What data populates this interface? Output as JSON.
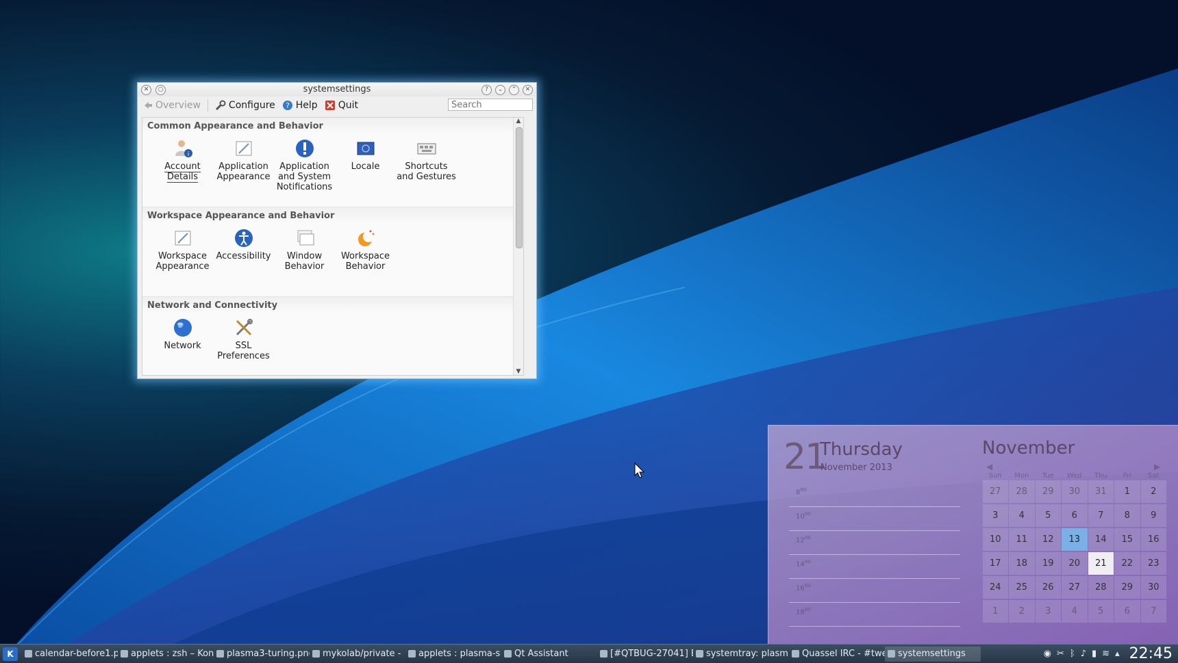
{
  "window": {
    "title": "systemsettings",
    "toolbar": {
      "overview": "Overview",
      "configure": "Configure",
      "help": "Help",
      "quit": "Quit",
      "search_placeholder": "Search"
    },
    "categories": [
      {
        "header": "Common Appearance and Behavior",
        "items": [
          {
            "line1": "Account",
            "line2": "Details",
            "line3": "",
            "icon": "user-info-icon"
          },
          {
            "line1": "Application",
            "line2": "Appearance",
            "line3": "",
            "icon": "brush-icon"
          },
          {
            "line1": "Application",
            "line2": "and System",
            "line3": "Notifications",
            "icon": "exclamation-icon"
          },
          {
            "line1": "Locale",
            "line2": "",
            "line3": "",
            "icon": "flag-icon"
          },
          {
            "line1": "Shortcuts",
            "line2": "and Gestures",
            "line3": "",
            "icon": "keyboard-icon"
          }
        ]
      },
      {
        "header": "Workspace Appearance and Behavior",
        "items": [
          {
            "line1": "Workspace",
            "line2": "Appearance",
            "line3": "",
            "icon": "brush-icon"
          },
          {
            "line1": "Accessibility",
            "line2": "",
            "line3": "",
            "icon": "accessibility-icon"
          },
          {
            "line1": "Window",
            "line2": "Behavior",
            "line3": "",
            "icon": "window-icon"
          },
          {
            "line1": "Workspace",
            "line2": "Behavior",
            "line3": "",
            "icon": "moon-icon"
          }
        ]
      },
      {
        "header": "Network and Connectivity",
        "items": [
          {
            "line1": "Network",
            "line2": "",
            "line3": "",
            "icon": "globe-icon"
          },
          {
            "line1": "SSL",
            "line2": "Preferences",
            "line3": "",
            "icon": "tools-icon"
          }
        ]
      }
    ]
  },
  "calendar": {
    "day_number": "21",
    "day_name": "Thursday",
    "month_year": "November 2013",
    "hours": [
      "8",
      "10",
      "12",
      "14",
      "16",
      "18"
    ],
    "hour_suffix": "00",
    "month": "November",
    "weekdays": [
      "Sun",
      "Mon",
      "Tue",
      "Wed",
      "Thu",
      "Fri",
      "Sat"
    ],
    "weeks": [
      [
        "27",
        "28",
        "29",
        "30",
        "31",
        "1",
        "2"
      ],
      [
        "3",
        "4",
        "5",
        "6",
        "7",
        "8",
        "9"
      ],
      [
        "10",
        "11",
        "12",
        "13",
        "14",
        "15",
        "16"
      ],
      [
        "17",
        "18",
        "19",
        "20",
        "21",
        "22",
        "23"
      ],
      [
        "24",
        "25",
        "26",
        "27",
        "28",
        "29",
        "30"
      ],
      [
        "1",
        "2",
        "3",
        "4",
        "5",
        "6",
        "7"
      ]
    ],
    "selected": "13",
    "today": "21"
  },
  "taskbar": {
    "tasks": [
      "calendar-before1.p",
      "applets : zsh – Kon",
      "plasma3-turing.pnc",
      "mykolab/private -",
      "applets : plasma-s",
      "Qt Assistant",
      "[#QTBUG-27041] E",
      "systemtray: plasm",
      "Quassel IRC - #twe",
      "systemsettings"
    ],
    "active_task": "systemsettings",
    "clock": "22:45"
  }
}
